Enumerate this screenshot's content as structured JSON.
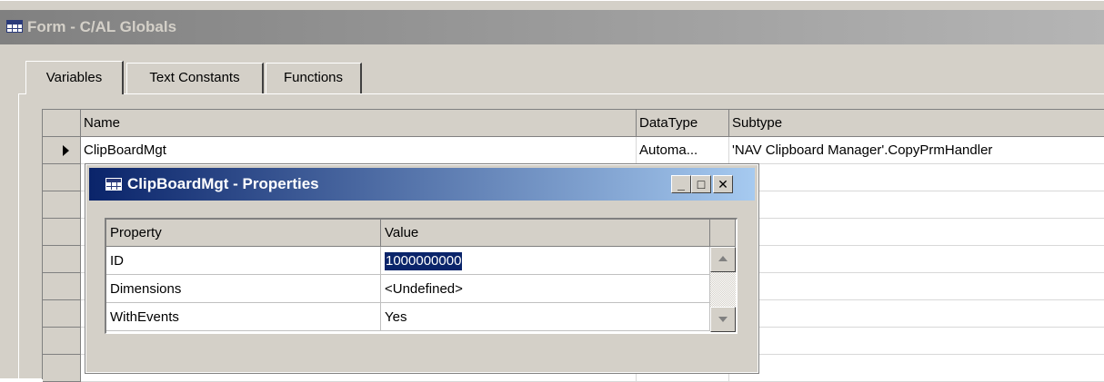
{
  "main_window": {
    "title": "Form - C/AL Globals",
    "icon": "form-icon"
  },
  "tabs": [
    {
      "label": "Variables",
      "active": true
    },
    {
      "label": "Text Constants",
      "active": false
    },
    {
      "label": "Functions",
      "active": false
    }
  ],
  "grid": {
    "columns": [
      "Name",
      "DataType",
      "Subtype"
    ],
    "rows": [
      {
        "name": "ClipBoardMgt",
        "datatype": "Automa...",
        "subtype": "'NAV Clipboard Manager'.CopyPrmHandler",
        "current": true
      }
    ]
  },
  "properties_window": {
    "title": "ClipBoardMgt - Properties",
    "icon": "form-icon",
    "buttons": {
      "minimize": "_",
      "maximize": "□",
      "close": "✕"
    },
    "columns": [
      "Property",
      "Value"
    ],
    "rows": [
      {
        "property": "ID",
        "value": "1000000000",
        "selected": true
      },
      {
        "property": "Dimensions",
        "value": "<Undefined>"
      },
      {
        "property": "WithEvents",
        "value": "Yes"
      }
    ]
  },
  "colors": {
    "active_title_start": "#0a246a",
    "active_title_end": "#a6caf0",
    "inactive_title_start": "#808080",
    "face": "#d4d0c8",
    "selection": "#0a246a"
  }
}
